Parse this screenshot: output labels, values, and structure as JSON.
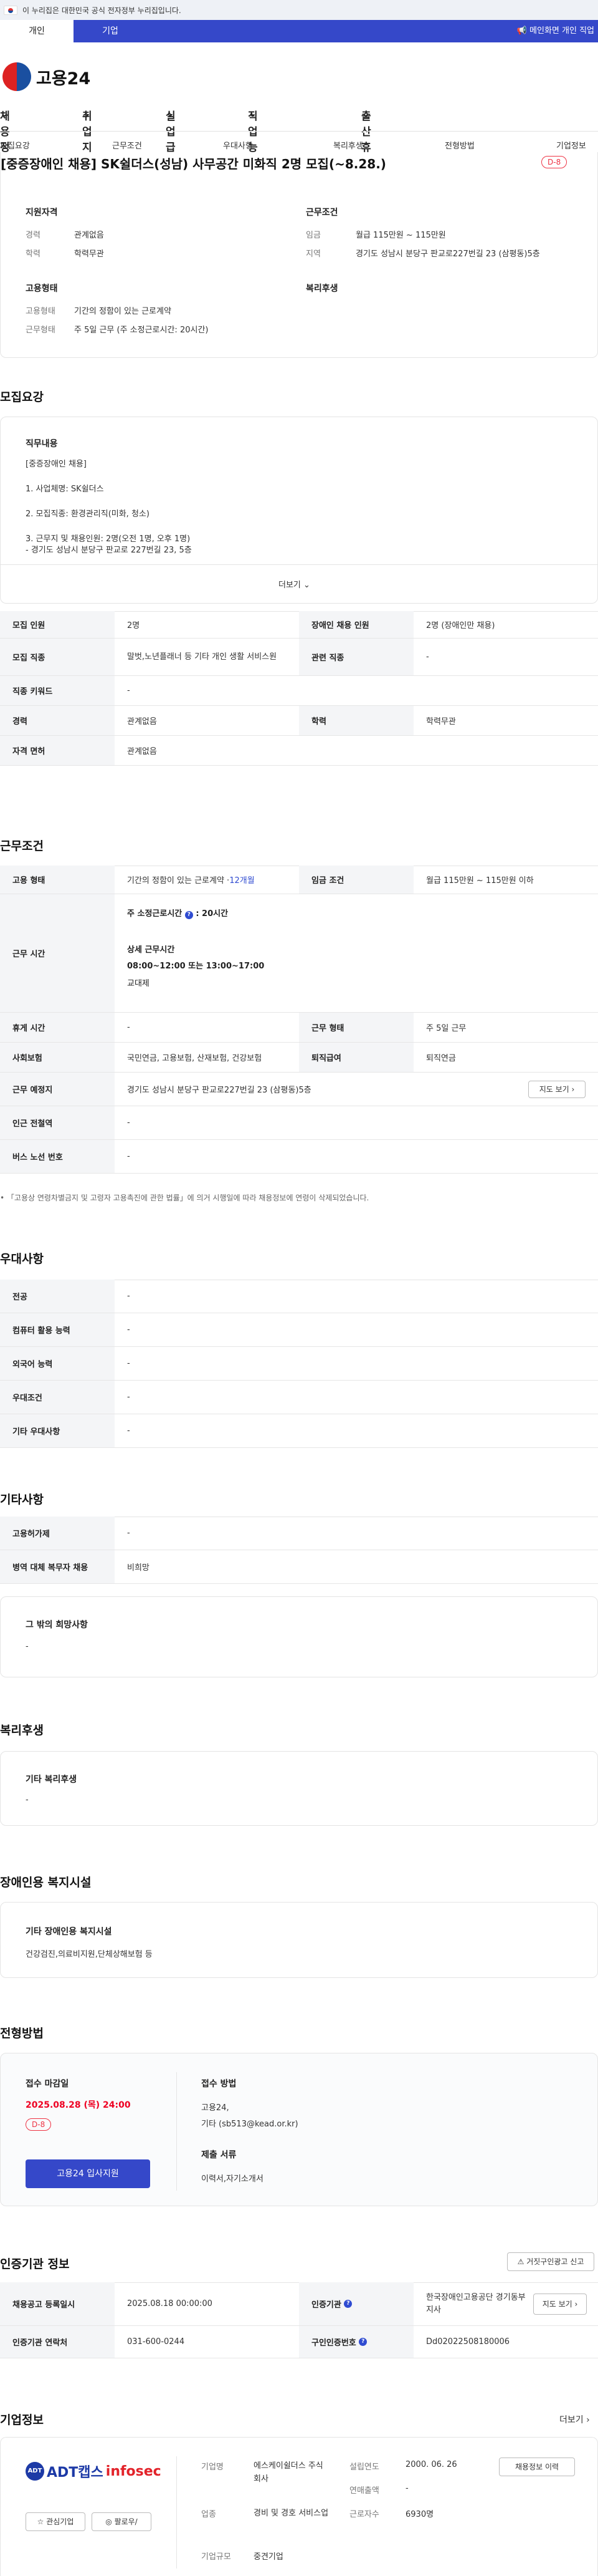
{
  "gov_banner": "이 누리집은 대한민국 공식 전자정부 누리집입니다.",
  "tabs": {
    "personal": "개인",
    "company": "기업",
    "main_link": "메인화면 개인 직업"
  },
  "logo_text": "고용24",
  "gnb": [
    "채용정보",
    "취업지원",
    "실업급여",
    "직업 능력 개발",
    "출산휴가·육아휴직"
  ],
  "subnav": [
    "모집요강",
    "근무조건",
    "우대사항",
    "복리후생",
    "전형방법",
    "기업정보"
  ],
  "job_title": "[중증장애인 채용] SK쉴더스(성남) 사무공간 미화직 2명 모집(~8.28.)",
  "d_day": "D-8",
  "summary": {
    "qual_title": "지원자격",
    "career_label": "경력",
    "career_value": "관계없음",
    "edu_label": "학력",
    "edu_value": "학력무관",
    "cond_title": "근무조건",
    "wage_label": "임금",
    "wage_value": "월급 115만원 ~ 115만원",
    "region_label": "지역",
    "region_value": "경기도 성남시 분당구 판교로227번길 23 (삼평동)5층",
    "emp_title": "고용형태",
    "emptype_label": "고용형태",
    "emptype_value": "기간의 정함이 있는 근로계약",
    "workform_label": "근무형태",
    "workform_value": "주 5일 근무 (주 소정근로시간: 20시간)",
    "welfare_title": "복리후생"
  },
  "recruit": {
    "section": "모집요강",
    "duty_title": "직무내용",
    "lines": [
      "[중증장애인 채용]",
      "1. 사업체명: SK쉴더스",
      "2. 모집직종: 환경관리직(미화, 청소)",
      "3. 근무지 및 채용인원: 2명(오전 1명, 오후 1명)",
      "- 경기도 성남시 분당구 판교로 227번길 23, 5층"
    ],
    "more": "더보기",
    "rows": [
      [
        "모집 인원",
        "2명",
        "장애인 채용 인원",
        "2명 (장애인만 채용)"
      ],
      [
        "모집 직종",
        "말벗,노년플래너 등 기타 개인 생활 서비스원",
        "관련 직종",
        "-"
      ],
      [
        "직종 키워드",
        "-"
      ],
      [
        "경력",
        "관계없음",
        "학력",
        "학력무관"
      ],
      [
        "자격 면허",
        "관계없음"
      ]
    ]
  },
  "conditions": {
    "section": "근무조건",
    "emp_label": "고용 형태",
    "emp_value": "기간의 정함이 있는 근로계약 · ",
    "emp_months": "12개월",
    "wage_label": "임금 조건",
    "wage_value": "월급 115만원 ~ 115만원 이하",
    "time_label": "근무 시간",
    "weekly_label": "주 소정근로시간",
    "weekly_value": ": 20시간",
    "detail_label": "상세 근무시간",
    "detail_value": "08:00~12:00 또는 13:00~17:00",
    "shift": "교대제",
    "holiday_label": "휴게 시간",
    "holiday_value": "-",
    "form_label": "근무 형태",
    "form_value": "주 5일 근무",
    "insurance_label": "사회보험",
    "insurance_value": "국민연금, 고용보험, 산재보험, 건강보험",
    "retire_label": "퇴직급여",
    "retire_value": "퇴직연금",
    "place_label": "근무 예정지",
    "place_value": "경기도 성남시 분당구 판교로227번길 23 (삼평동)5층",
    "map_btn": "지도 보기",
    "station_label": "인근 전철역",
    "station_value": "-",
    "bus_label": "버스 노선 번호",
    "bus_value": "-",
    "notice": "「고용상 연령차별금지 및 고령자 고용촉진에 관한 법률」에 의거 시행일에 따라 채용정보에 연령이 삭제되었습니다."
  },
  "preference": {
    "section": "우대사항",
    "rows": [
      [
        "전공",
        "-"
      ],
      [
        "컴퓨터 활용 능력",
        "-"
      ],
      [
        "외국어 능력",
        "-"
      ],
      [
        "우대조건",
        "-"
      ],
      [
        "기타 우대사항",
        "-"
      ]
    ]
  },
  "others": {
    "section": "기타사항",
    "rows": [
      [
        "고용허가제",
        "-"
      ],
      [
        "병역 대체 복무자 채용",
        "비희망"
      ]
    ],
    "etc_title": "그 밖의 희망사항",
    "etc_value": "-"
  },
  "welfare": {
    "section": "복리후생",
    "title": "기타 복리후생",
    "value": "-"
  },
  "facility": {
    "section": "장애인용 복지시설",
    "title": "기타 장애인용 복지시설",
    "value": "건강검진,의료비지원,단체상해보험 등"
  },
  "selection": {
    "section": "전형방법",
    "deadline_title": "접수 마감일",
    "deadline_value": "2025.08.28 (목) 24:00",
    "d_day": "D-8",
    "apply_btn": "고용24 입사지원",
    "method_title": "접수 방법",
    "method_lines": [
      "고용24,",
      "기타 (sb513@kead.or.kr)"
    ],
    "docs_title": "제출 서류",
    "docs_value": "이력서,자기소개서"
  },
  "agency": {
    "section": "인증기관 정보",
    "report_btn": "거짓구인광고 신고",
    "row1": [
      "채용공고 등록일시",
      "2025.08.18 00:00:00",
      "인증기관",
      "한국장애인고용공단 경기동부지사",
      "지도 보기"
    ],
    "row2": [
      "인증기관 연락처",
      "031-600-0244",
      "구인인증번호",
      "Dd02022508180006"
    ]
  },
  "company": {
    "section": "기업정보",
    "more": "더보기",
    "logo_text": "ADT캡스",
    "logo_sub": "infosec",
    "fav_btn": "관심기업",
    "follow_btn": "팔로우/",
    "industry_label": "기업명",
    "industry_value": "에스케이쉴더스 주식회사",
    "biz_label": "업종",
    "biz_value": "경비 및 경호 서비스업",
    "size_label": "기업규모",
    "size_value": "중견기업",
    "founded_label": "설립연도",
    "founded_value": "2000. 06. 26",
    "revenue_label": "연매출액",
    "revenue_value": "-",
    "staff_label": "근로자수",
    "staff_value": "6930명",
    "job_btn": "채용정보 이력"
  }
}
